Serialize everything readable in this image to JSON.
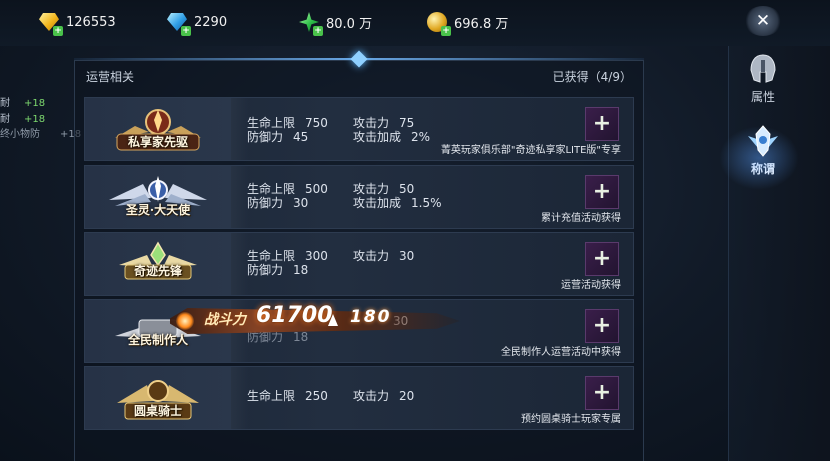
{
  "currency": [
    {
      "icon": "gold-diamond-icon",
      "value": "126553"
    },
    {
      "icon": "blue-diamond-icon",
      "value": "2290"
    },
    {
      "icon": "green-crystal-icon",
      "value": "80.0 万"
    },
    {
      "icon": "gold-coin-icon",
      "value": "696.8 万"
    }
  ],
  "close_label": "✕",
  "left_stats": [
    {
      "label": "耐",
      "value": "+18"
    },
    {
      "label": "耐",
      "value": "+18"
    },
    {
      "label": "终小物防",
      "value": "+18"
    }
  ],
  "panel": {
    "title": "运营相关",
    "obtained": "已获得（4/9）"
  },
  "rows": [
    {
      "badge_title": "私享家先驱",
      "stats": [
        {
          "label": "生命上限",
          "value": "750"
        },
        {
          "label": "攻击力",
          "value": "75"
        },
        {
          "label": "防御力",
          "value": "45"
        },
        {
          "label": "攻击加成",
          "value": "2%"
        }
      ],
      "source": "菁英玩家俱乐部\"奇迹私享家LITE版\"专享"
    },
    {
      "badge_title": "圣灵·大天使",
      "stats": [
        {
          "label": "生命上限",
          "value": "500"
        },
        {
          "label": "攻击力",
          "value": "50"
        },
        {
          "label": "防御力",
          "value": "30"
        },
        {
          "label": "攻击加成",
          "value": "1.5%"
        }
      ],
      "source": "累计充值活动获得"
    },
    {
      "badge_title": "奇迹先锋",
      "stats": [
        {
          "label": "生命上限",
          "value": "300"
        },
        {
          "label": "攻击力",
          "value": "30"
        },
        {
          "label": "防御力",
          "value": "18"
        }
      ],
      "source": "运营活动获得"
    },
    {
      "badge_title": "全民制作人",
      "stats": [
        {
          "label": "攻击力",
          "value": "30"
        },
        {
          "label": "防御力",
          "value": "18"
        }
      ],
      "source": "全民制作人运营活动中获得"
    },
    {
      "badge_title": "圆桌骑士",
      "stats": [
        {
          "label": "生命上限",
          "value": "250"
        },
        {
          "label": "攻击力",
          "value": "20"
        }
      ],
      "source": "预约圆桌骑士玩家专属"
    }
  ],
  "power_popup": {
    "label": "战斗力",
    "value": "61700",
    "delta": "180"
  },
  "tabs": [
    {
      "label": "属性",
      "icon": "helmet-icon",
      "active": false
    },
    {
      "label": "称谓",
      "icon": "winged-crest-icon",
      "active": true
    }
  ],
  "colors": {
    "accent": "#6aa9e8",
    "stat_positive": "#7dd86e",
    "slot_purple": "#3a1e4a"
  }
}
